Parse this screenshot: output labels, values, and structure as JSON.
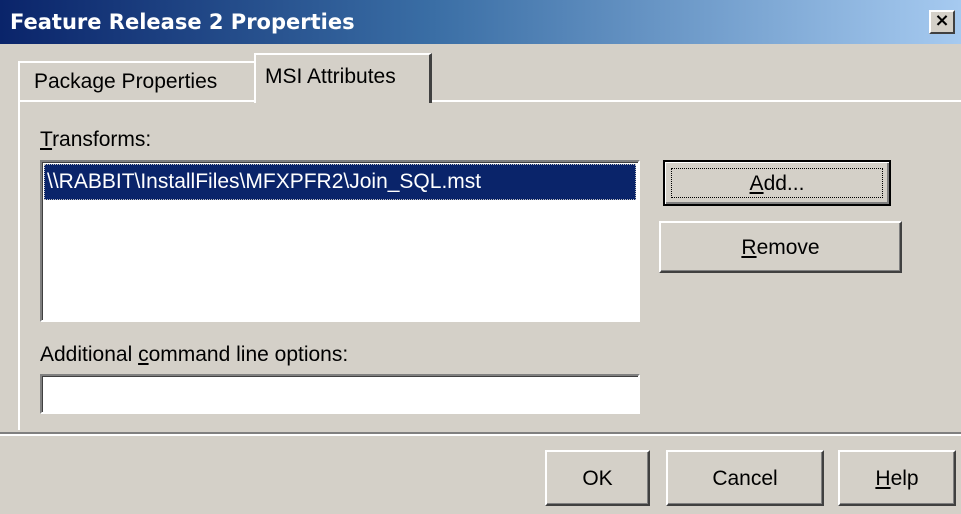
{
  "window": {
    "title": "Feature Release 2 Properties",
    "close_glyph": "×"
  },
  "tabs": [
    {
      "label": "Package Properties",
      "selected": false
    },
    {
      "label": "MSI Attributes",
      "selected": true
    }
  ],
  "transforms": {
    "label_prefix": "",
    "label_mnemonic": "T",
    "label_rest": "ransforms:",
    "items": [
      {
        "text": "\\\\RABBIT\\InstallFiles\\MFXPFR2\\Join_SQL.mst",
        "selected": true
      }
    ]
  },
  "buttons": {
    "add": {
      "mnemonic": "A",
      "rest": "dd..."
    },
    "remove": {
      "mnemonic": "R",
      "rest": "emove"
    },
    "ok": {
      "label": "OK"
    },
    "cancel": {
      "label": "Cancel"
    },
    "help": {
      "mnemonic": "H",
      "rest": "elp"
    }
  },
  "command_line": {
    "label_prefix": "Additional ",
    "label_mnemonic": "c",
    "label_rest": "ommand line options:",
    "value": "",
    "placeholder": ""
  },
  "colors": {
    "face": "#d4d0c8",
    "title_active_start": "#0a246a",
    "title_active_end": "#a6caf0",
    "selection": "#0a246a"
  },
  "icons": {
    "close": "close-icon"
  }
}
